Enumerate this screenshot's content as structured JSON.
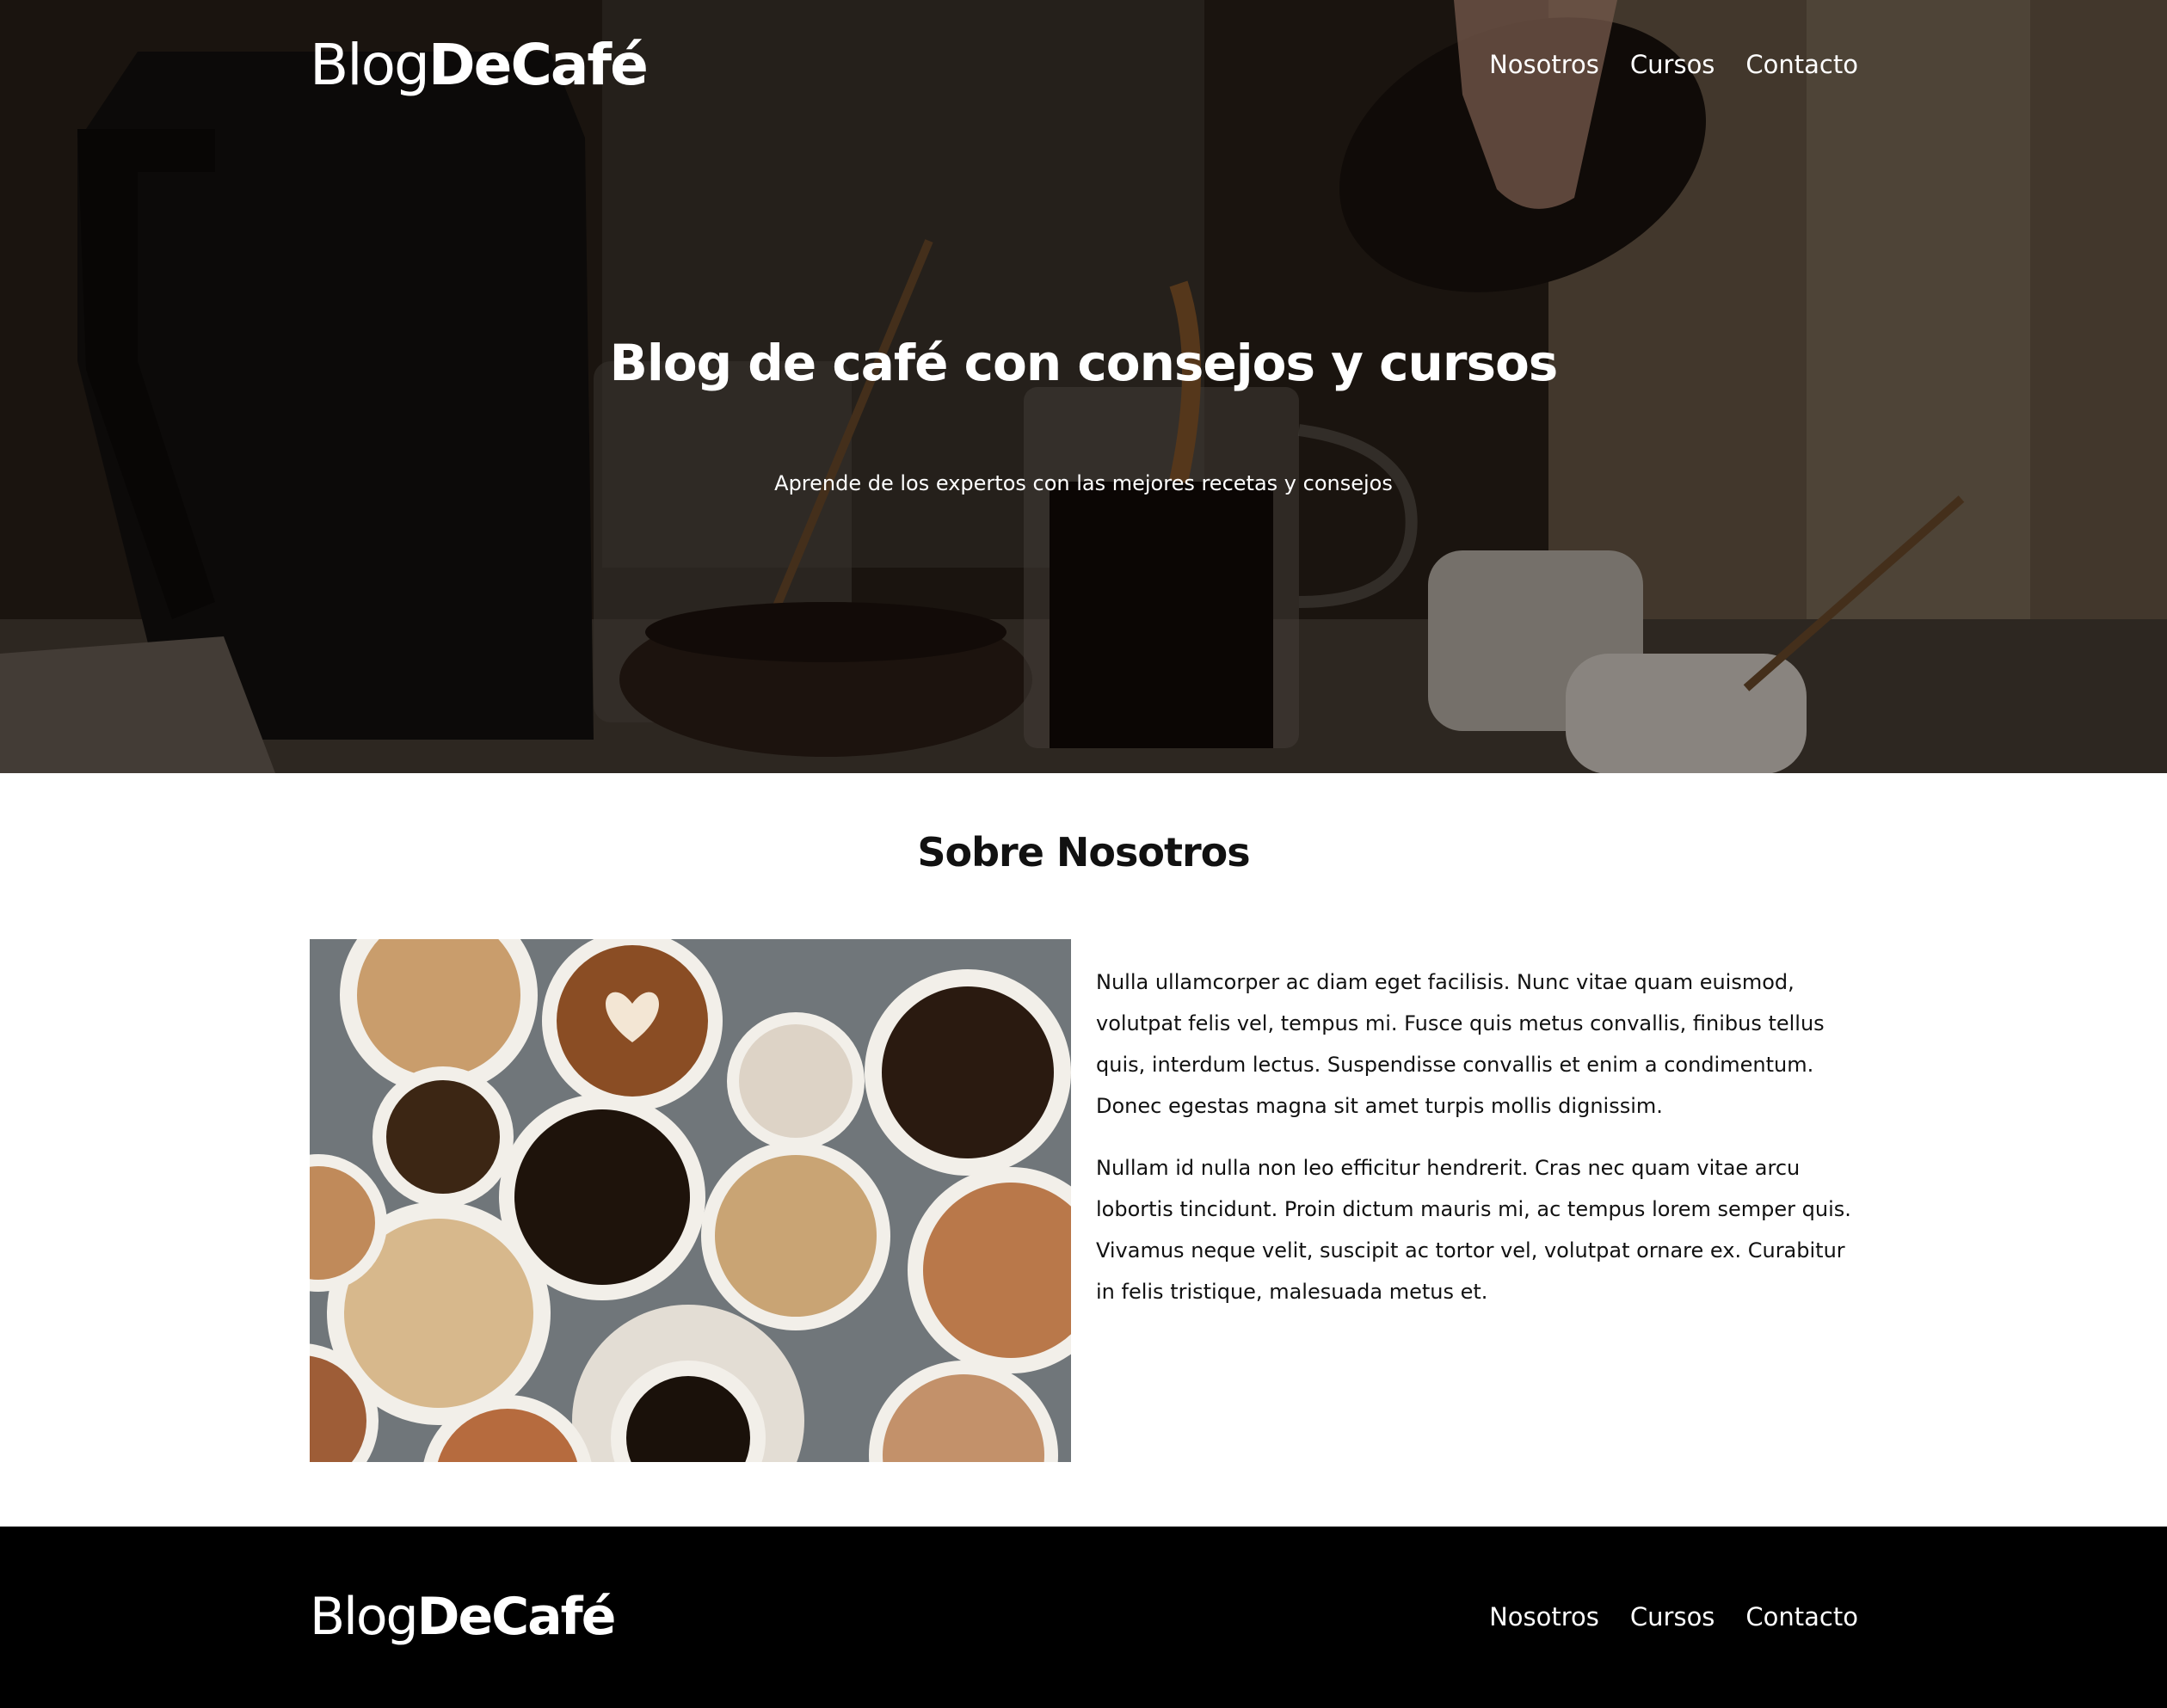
{
  "header": {
    "logo": {
      "light": "Blog",
      "bold": "DeCafé"
    },
    "nav": [
      {
        "label": "Nosotros"
      },
      {
        "label": "Cursos"
      },
      {
        "label": "Contacto"
      }
    ]
  },
  "hero": {
    "title": "Blog de café con consejos y cursos",
    "subtitle": "Aprende de los expertos con las mejores recetas y consejos"
  },
  "about": {
    "title": "Sobre Nosotros",
    "paragraphs": [
      "Nulla ullamcorper ac diam eget facilisis. Nunc vitae quam euismod, volutpat felis vel, tempus mi. Fusce quis metus convallis, finibus tellus quis, interdum lectus. Suspendisse convallis et enim a condimentum. Donec egestas magna sit amet turpis mollis dignissim.",
      "Nullam id nulla non leo efficitur hendrerit. Cras nec quam vitae arcu lobortis tincidunt. Proin dictum mauris mi, ac tempus lorem semper quis. Vivamus neque velit, suscipit ac tortor vel, volutpat ornare ex. Curabitur in felis tristique, malesuada metus et."
    ]
  },
  "footer": {
    "logo": {
      "light": "Blog",
      "bold": "DeCafé"
    },
    "nav": [
      {
        "label": "Nosotros"
      },
      {
        "label": "Cursos"
      },
      {
        "label": "Contacto"
      }
    ]
  },
  "colors": {
    "hero_overlay": "#000000",
    "text_light": "#ffffff",
    "text_dark": "#111111",
    "footer_bg": "#000000"
  }
}
